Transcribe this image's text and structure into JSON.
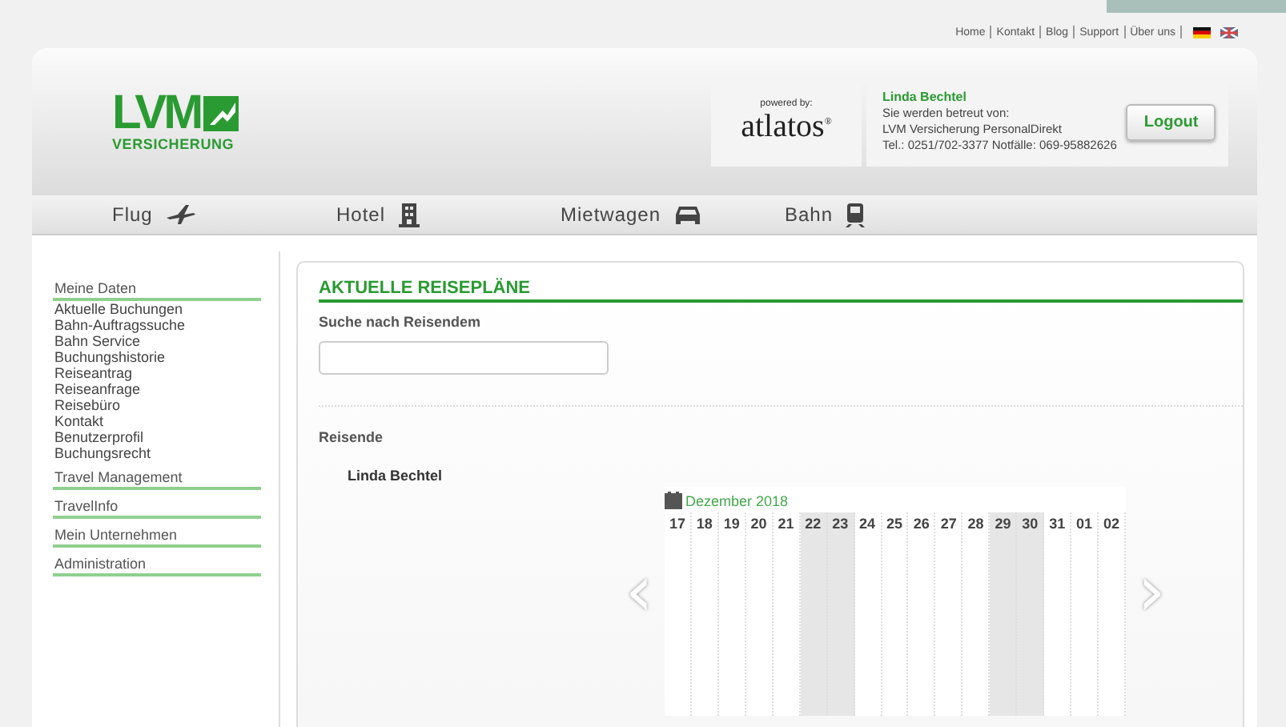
{
  "top_links": [
    "Home",
    "Kontakt",
    "Blog",
    "Support",
    "Über uns"
  ],
  "languages": [
    {
      "kind": "de",
      "selected": true
    },
    {
      "kind": "en",
      "selected": false
    }
  ],
  "logo": {
    "mark": "LVM",
    "subtitle": "VERSICHERUNG"
  },
  "powered": {
    "label": "powered by:",
    "brand": "atlatos",
    "reg": "®"
  },
  "user": {
    "name": "Linda Bechtel",
    "lines": [
      "Sie werden betreut von:",
      "LVM Versicherung PersonalDirekt",
      "Tel.: 0251/702-3377 Notfälle: 069-95882626"
    ],
    "logout": "Logout"
  },
  "nav": [
    {
      "label": "Flug",
      "kind": "plane"
    },
    {
      "label": "Hotel",
      "kind": "hotel"
    },
    {
      "label": "Mietwagen",
      "kind": "car"
    },
    {
      "label": "Bahn",
      "kind": "train"
    }
  ],
  "sidebar": [
    {
      "label": "Meine Daten",
      "children": [
        {
          "label": "Aktuelle Buchungen"
        },
        {
          "label": "Bahn-Auftragssuche"
        },
        {
          "label": "Bahn Service"
        },
        {
          "label": "Buchungshistorie"
        },
        {
          "label": "Reiseantrag"
        },
        {
          "label": "Reiseanfrage"
        },
        {
          "label": "Reisebüro"
        },
        {
          "label": "Kontakt"
        },
        {
          "label": "Benutzerprofil"
        },
        {
          "label": "Buchungsrecht"
        }
      ]
    },
    {
      "label": "Travel Management"
    },
    {
      "label": "TravelInfo"
    },
    {
      "label": "Mein Unternehmen"
    },
    {
      "label": "Administration"
    }
  ],
  "main": {
    "title": "AKTUELLE REISEPLÄNE",
    "search_label": "Suche nach Reisendem",
    "travellers_label": "Reisende",
    "traveller": "Linda Bechtel"
  },
  "calendar": {
    "month": "Dezember 2018",
    "prev": "‹",
    "next": "›",
    "days": [
      {
        "label": "17",
        "weekend": false
      },
      {
        "label": "18",
        "weekend": false
      },
      {
        "label": "19",
        "weekend": false
      },
      {
        "label": "20",
        "weekend": false
      },
      {
        "label": "21",
        "weekend": false
      },
      {
        "label": "22",
        "weekend": true
      },
      {
        "label": "23",
        "weekend": true
      },
      {
        "label": "24",
        "weekend": false
      },
      {
        "label": "25",
        "weekend": false
      },
      {
        "label": "26",
        "weekend": false
      },
      {
        "label": "27",
        "weekend": false
      },
      {
        "label": "28",
        "weekend": false
      },
      {
        "label": "29",
        "weekend": true
      },
      {
        "label": "30",
        "weekend": true
      },
      {
        "label": "31",
        "weekend": false
      },
      {
        "label": "01",
        "weekend": false
      },
      {
        "label": "02",
        "weekend": false
      }
    ]
  }
}
